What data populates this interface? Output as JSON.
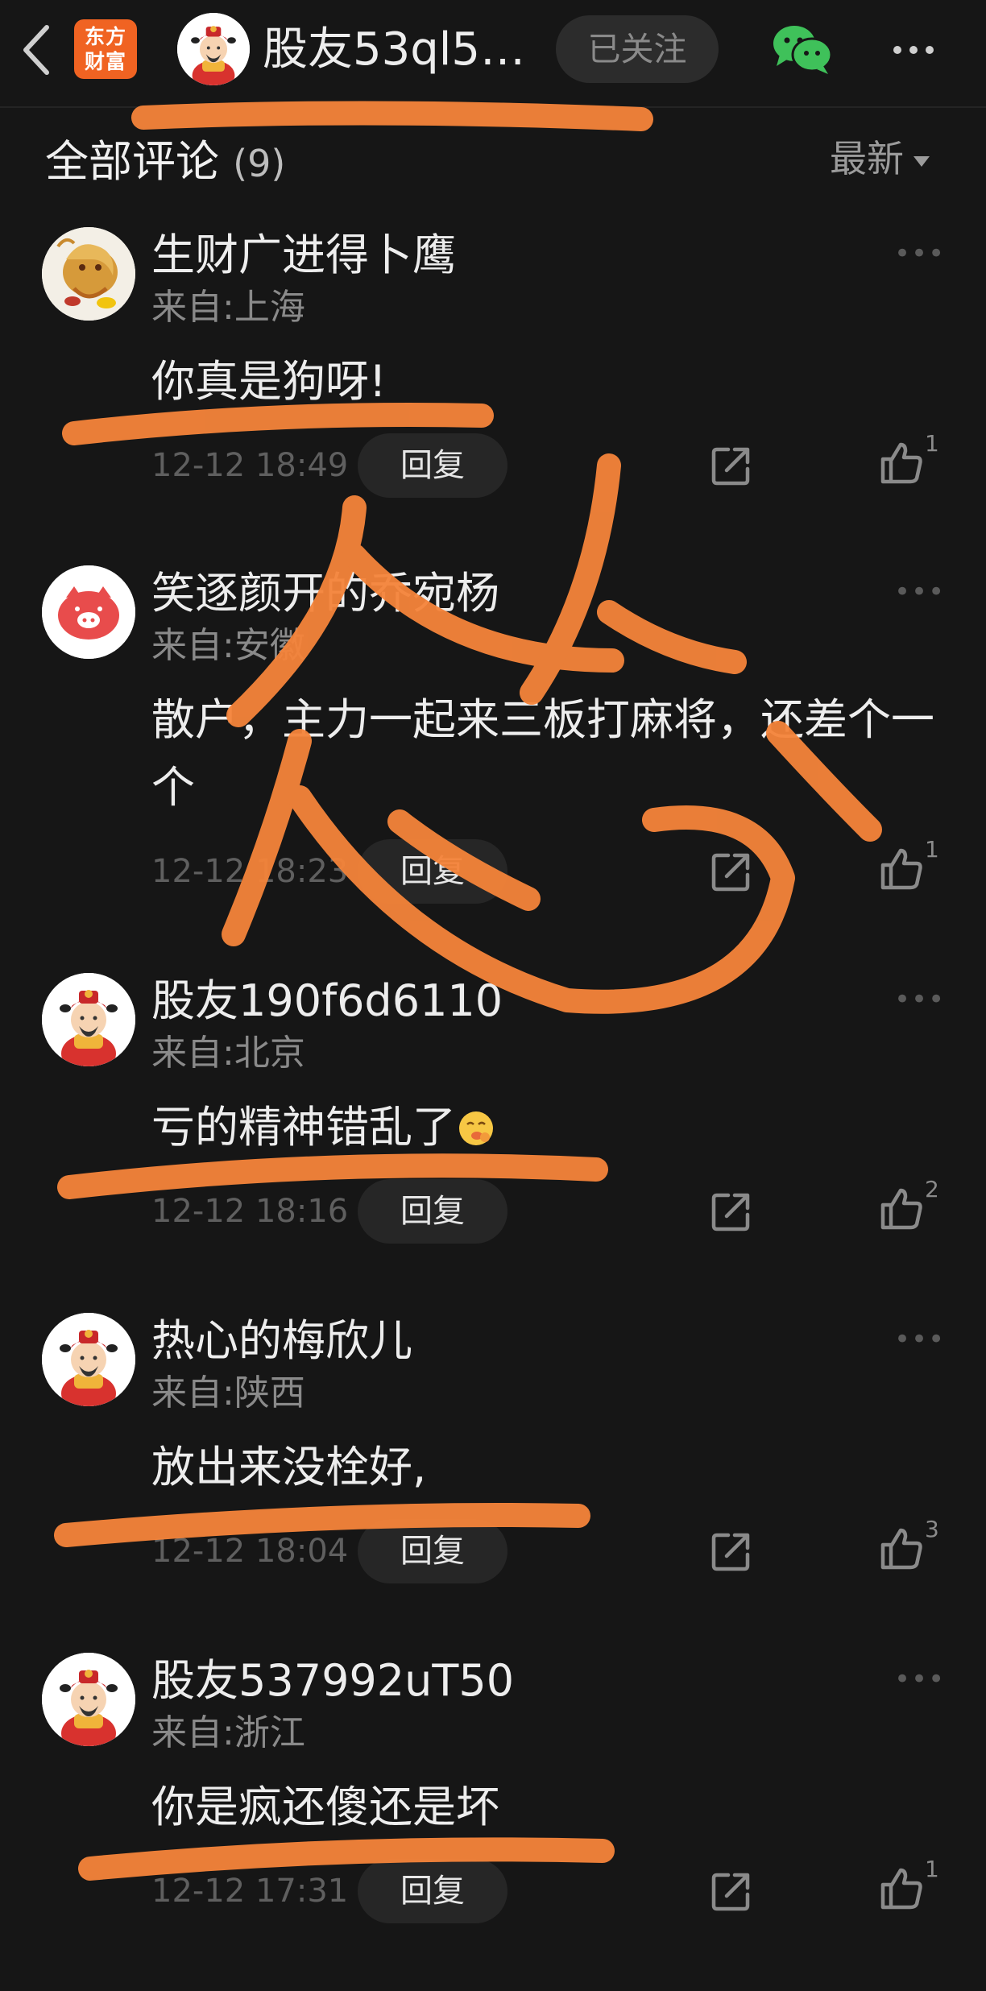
{
  "header": {
    "brand_line1": "东方",
    "brand_line2": "财富",
    "user_name": "股友53ql5…",
    "follow_label": "已关注"
  },
  "section": {
    "title": "全部评论",
    "count": "(9)",
    "sort_label": "最新"
  },
  "colors": {
    "background": "#161616",
    "brand": "#f06322",
    "wechat": "#3fc15a",
    "marker": "#f5843a"
  },
  "comments": [
    {
      "user": "生财广进得卜鹰",
      "location": "来自:上海",
      "text": "你真是狗呀!",
      "time": "12-12 18:49",
      "reply_label": "回复",
      "likes": "1",
      "avatar_icon": "golden-dragon-avatar"
    },
    {
      "user": "笑逐颜开的乔宛杨",
      "location": "来自:安徽",
      "text": "散户，主力一起来三板打麻将，还差个一个",
      "time": "12-12 18:23",
      "reply_label": "回复",
      "likes": "1",
      "avatar_icon": "pig-avatar"
    },
    {
      "user": "股友190f6d6110",
      "location": "来自:北京",
      "text": "亏的精神错乱了",
      "time": "12-12 18:16",
      "reply_label": "回复",
      "likes": "2",
      "avatar_icon": "fortune-god-avatar"
    },
    {
      "user": "热心的梅欣儿",
      "location": "来自:陕西",
      "text": "放出来没栓好,",
      "time": "12-12 18:04",
      "reply_label": "回复",
      "likes": "3",
      "avatar_icon": "fortune-god-avatar"
    },
    {
      "user": "股友537992uT50",
      "location": "来自:浙江",
      "text": "你是疯还傻还是坏",
      "time": "12-12 17:31",
      "reply_label": "回复",
      "likes": "1",
      "avatar_icon": "fortune-god-avatar"
    }
  ]
}
